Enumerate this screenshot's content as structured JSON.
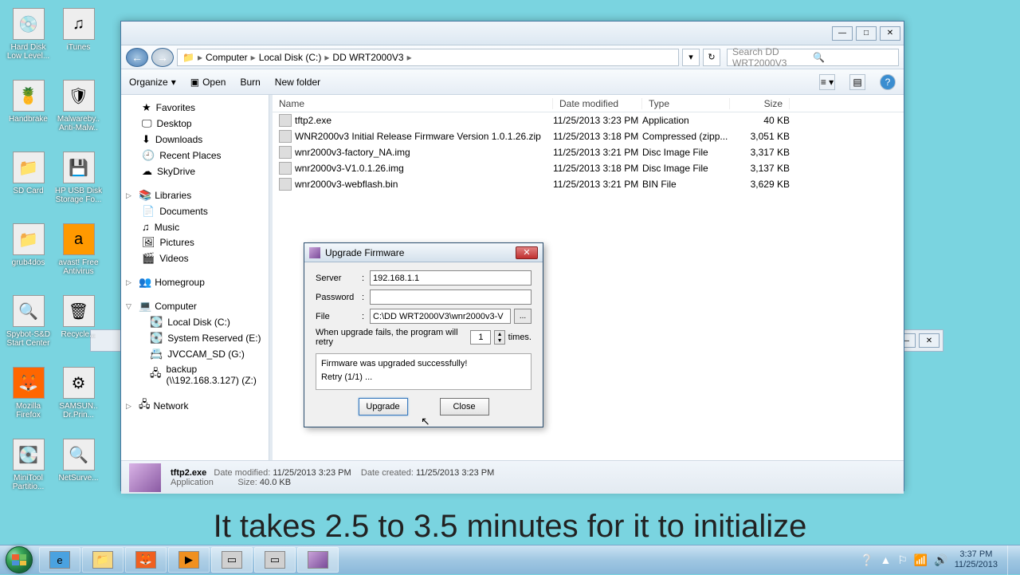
{
  "desktop": {
    "icons": [
      [
        "Hard Disk Low Level...",
        "iTunes"
      ],
      [
        "Handbrake",
        "Malwareby.. Anti-Malw.."
      ],
      [
        "SD Card",
        "HP USB Disk Storage Fo..."
      ],
      [
        "grub4dos",
        "avast! Free Antivirus"
      ],
      [
        "Spybot-S&D Start Center",
        "Recycle..."
      ],
      [
        "Mozilla Firefox",
        "SAMSUN.. Dr.Prin..."
      ],
      [
        "MiniTool Partitio...",
        "NetSurve..."
      ]
    ]
  },
  "explorer": {
    "breadcrumb": [
      "Computer",
      "Local Disk (C:)",
      "DD WRT2000V3"
    ],
    "search_placeholder": "Search DD WRT2000V3",
    "toolbar": {
      "organize": "Organize",
      "open": "Open",
      "burn": "Burn",
      "newfolder": "New folder"
    },
    "nav": {
      "favorites": "Favorites",
      "fav_items": [
        "Desktop",
        "Downloads",
        "Recent Places",
        "SkyDrive"
      ],
      "libraries": "Libraries",
      "lib_items": [
        "Documents",
        "Music",
        "Pictures",
        "Videos"
      ],
      "homegroup": "Homegroup",
      "computer": "Computer",
      "comp_items": [
        "Local Disk (C:)",
        "System Reserved (E:)",
        "JVCCAM_SD (G:)",
        "backup (\\\\192.168.3.127) (Z:)"
      ],
      "network": "Network"
    },
    "columns": {
      "name": "Name",
      "date": "Date modified",
      "type": "Type",
      "size": "Size"
    },
    "files": [
      {
        "name": "tftp2.exe",
        "date": "11/25/2013 3:23 PM",
        "type": "Application",
        "size": "40 KB"
      },
      {
        "name": "WNR2000v3 Initial Release Firmware Version 1.0.1.26.zip",
        "date": "11/25/2013 3:18 PM",
        "type": "Compressed (zipp...",
        "size": "3,051 KB"
      },
      {
        "name": "wnr2000v3-factory_NA.img",
        "date": "11/25/2013 3:21 PM",
        "type": "Disc Image File",
        "size": "3,317 KB"
      },
      {
        "name": "wnr2000v3-V1.0.1.26.img",
        "date": "11/25/2013 3:18 PM",
        "type": "Disc Image File",
        "size": "3,137 KB"
      },
      {
        "name": "wnr2000v3-webflash.bin",
        "date": "11/25/2013 3:21 PM",
        "type": "BIN File",
        "size": "3,629 KB"
      }
    ],
    "details": {
      "filename": "tftp2.exe",
      "filetype": "Application",
      "mod_label": "Date modified:",
      "mod_val": "11/25/2013 3:23 PM",
      "created_label": "Date created:",
      "created_val": "11/25/2013 3:23 PM",
      "size_label": "Size:",
      "size_val": "40.0 KB"
    }
  },
  "dialog": {
    "title": "Upgrade Firmware",
    "server_label": "Server",
    "server_val": "192.168.1.1",
    "password_label": "Password",
    "password_val": "",
    "file_label": "File",
    "file_val": "C:\\DD WRT2000V3\\wnr2000v3-V",
    "retry_pre": "When upgrade fails, the program will retry",
    "retry_val": "1",
    "retry_post": "times.",
    "status1": "Firmware was upgraded successfully!",
    "status2": "Retry (1/1) ...",
    "upgrade_btn": "Upgrade",
    "close_btn": "Close"
  },
  "caption": "It takes 2.5 to 3.5 minutes for it to initialize",
  "taskbar": {
    "time": "3:37 PM",
    "date": "11/25/2013"
  }
}
